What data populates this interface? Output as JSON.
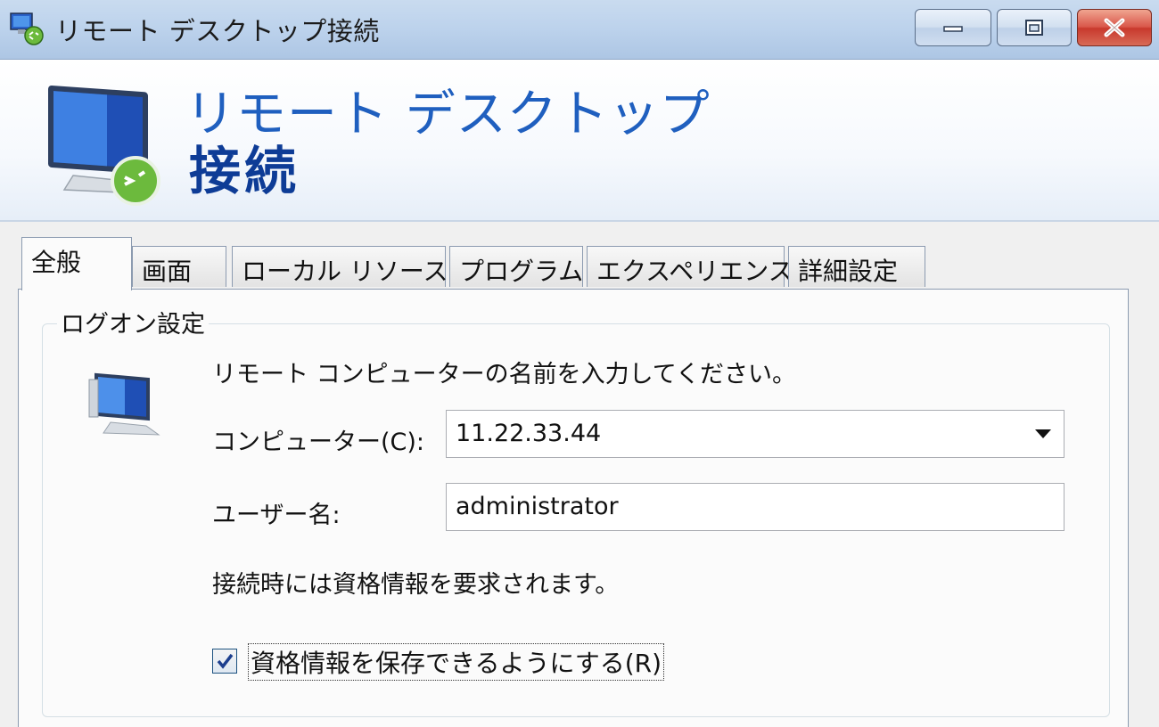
{
  "window": {
    "title": "リモート デスクトップ接続",
    "icon": "remote-desktop-icon"
  },
  "banner": {
    "line1": "リモート デスクトップ",
    "line2": "接続"
  },
  "tabs": [
    {
      "label": "全般",
      "active": true
    },
    {
      "label": "画面",
      "active": false
    },
    {
      "label": "ローカル リソース",
      "active": false
    },
    {
      "label": "プログラム",
      "active": false
    },
    {
      "label": "エクスペリエンス",
      "active": false
    },
    {
      "label": "詳細設定",
      "active": false
    }
  ],
  "logon": {
    "group_title": "ログオン設定",
    "prompt": "リモート コンピューターの名前を入力してください。",
    "computer_label": "コンピューター(C):",
    "computer_value": "11.22.33.44",
    "user_label": "ユーザー名:",
    "user_value": "administrator",
    "info": "接続時には資格情報を要求されます。",
    "save_credentials_label": "資格情報を保存できるようにする(R)",
    "save_credentials_checked": true
  },
  "colors": {
    "accent_title": "#1f5fbf",
    "accent_title_bold": "#0e3c96",
    "close_button": "#c8392d"
  }
}
